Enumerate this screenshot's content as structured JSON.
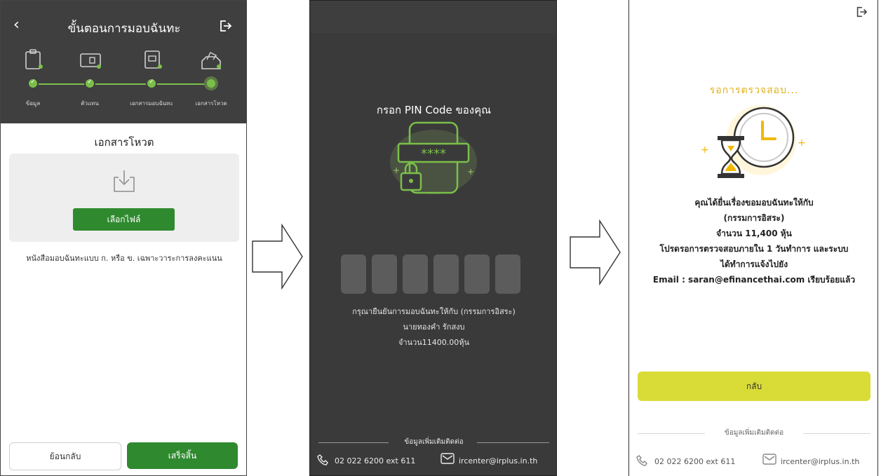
{
  "panel1": {
    "title": "ขั้นตอนการมอบฉันทะ",
    "steps": [
      "ข้อมูล",
      "ตัวแทน",
      "เอกสารมอบฉันทะ",
      "เอกสารโหวต"
    ],
    "sheet_title": "เอกสารโหวต",
    "select_file_label": "เลือกไฟล์",
    "description": "หนังสือมอบฉันทะแบบ ก. หรือ ข. เฉพาะวาระการลงคะแนน",
    "back_label": "ย้อนกลับ",
    "done_label": "เสร็จสิ้น",
    "accent": "#2f8a2f"
  },
  "panel2": {
    "pin_title": "กรอก PIN Code ของคุณ",
    "pin_stars": "****",
    "confirm_line1": "กรุณายืนยันการมอบฉันทะให้กับ (กรรมการอิสระ)",
    "confirm_line2": "นายทองคำ รักสงบ",
    "confirm_line3": "จำนวน11400.00หุ้น",
    "footer_label": "ข้อมูลเพิ่มเติมติดต่อ",
    "phone": "02 022 6200 ext 611",
    "email": "ircenter@irplus.in.th"
  },
  "panel3": {
    "waiting": "รอการตรวจสอบ...",
    "msg_line1": "คุณได้ยื่นเรื่องขอมอบฉันทะให้กับ",
    "msg_line2": "(กรรมการอิสระ)",
    "msg_line3": "จำนวน 11,400 หุ้น",
    "msg_line4": "โปรดรอการตรวจสอบภายใน 1 วันทำการ และระบบ",
    "msg_line5": "ได้ทำการแจ้งไปยัง",
    "msg_line6": "Email : saran@efinancethai.com เรียบร้อยแล้ว",
    "return_label": "กลับ",
    "footer_label": "ข้อมูลเพิ่มเติมติดต่อ",
    "phone": "02 022 6200 ext 611",
    "email": "ircenter@irplus.in.th",
    "accent": "#d9dc37"
  }
}
